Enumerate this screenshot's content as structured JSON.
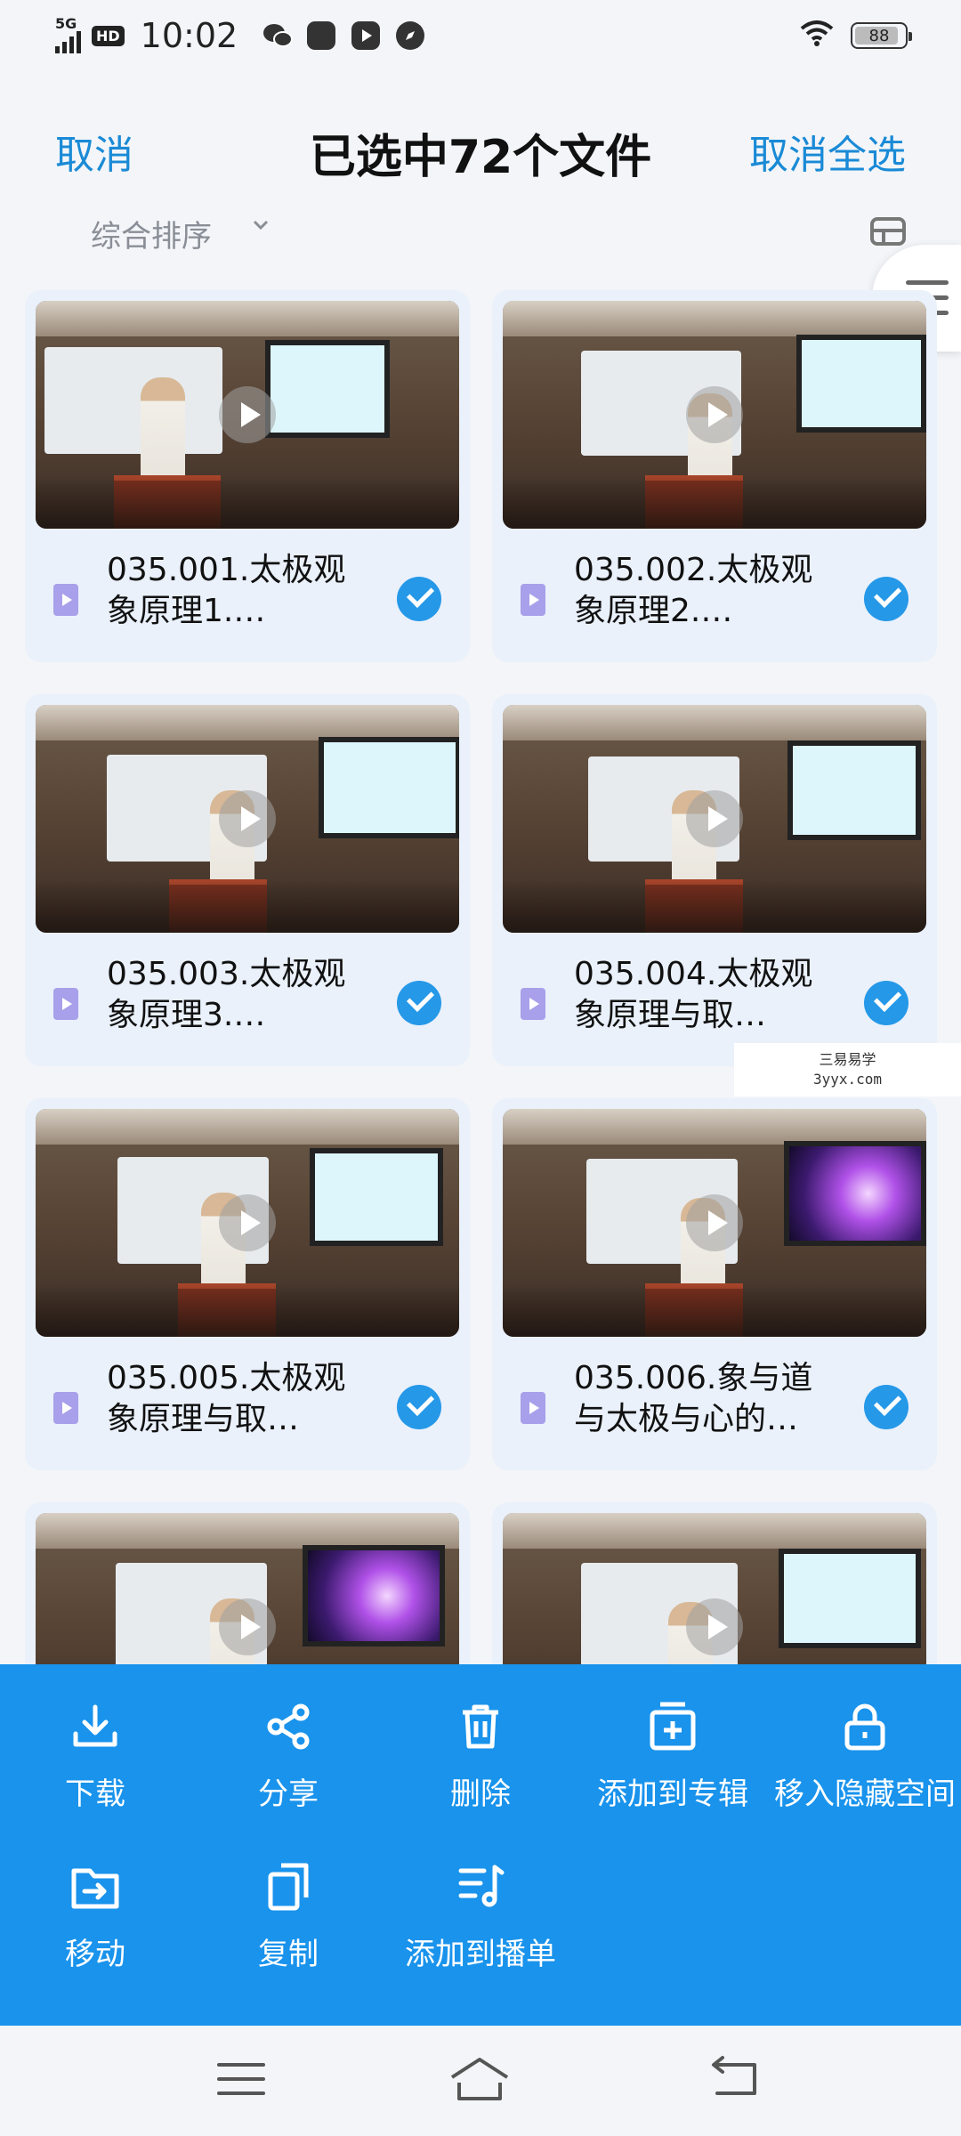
{
  "status_bar": {
    "network": "5G",
    "hd": "HD",
    "time": "10:02",
    "battery": "88"
  },
  "header": {
    "cancel_label": "取消",
    "title": "已选中72个文件",
    "deselect_all_label": "取消全选"
  },
  "sort": {
    "label": "综合排序"
  },
  "files": [
    {
      "name": "035.001.太极观象原理1.…",
      "selected": true
    },
    {
      "name": "035.002.太极观象原理2.…",
      "selected": true
    },
    {
      "name": "035.003.太极观象原理3.…",
      "selected": true
    },
    {
      "name": "035.004.太极观象原理与取…",
      "selected": true
    },
    {
      "name": "035.005.太极观象原理与取…",
      "selected": true
    },
    {
      "name": "035.006.象与道与太极与心的…",
      "selected": true
    }
  ],
  "watermark": {
    "line1": "三易易学",
    "line2": "3yyx.com"
  },
  "actions": {
    "download": "下载",
    "share": "分享",
    "delete": "删除",
    "add_to_album": "添加到专辑",
    "move_to_hidden": "移入隐藏空间",
    "move": "移动",
    "copy": "复制",
    "add_to_playlist": "添加到播单"
  },
  "colors": {
    "accent": "#1a8ad6",
    "action_bar": "#1993ec",
    "check": "#2598e8"
  }
}
